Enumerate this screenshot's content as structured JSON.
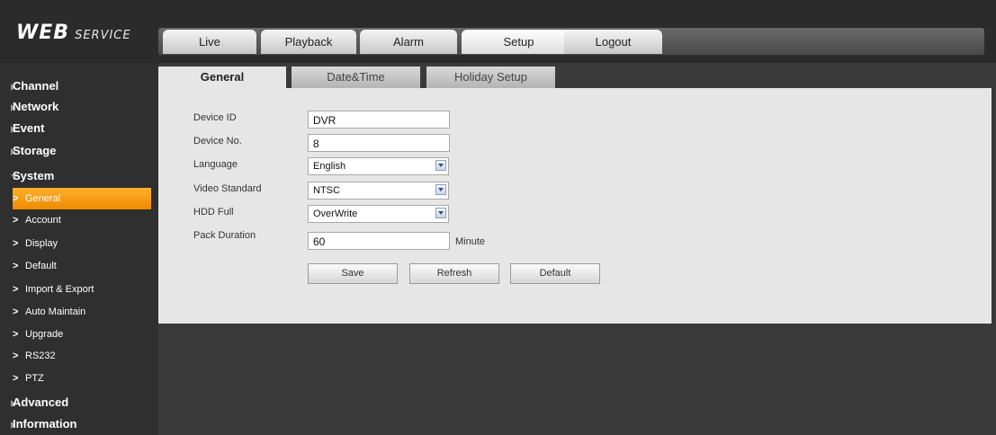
{
  "logo": {
    "big": "WEB",
    "small": "SERVICE"
  },
  "top_tabs": [
    {
      "label": "Live"
    },
    {
      "label": "Playback"
    },
    {
      "label": "Alarm"
    },
    {
      "label": "Setup",
      "active": true
    },
    {
      "label": "Logout"
    }
  ],
  "sidebar": {
    "categories": {
      "channel": "Channel",
      "network": "Network",
      "event": "Event",
      "storage": "Storage",
      "system": "System",
      "advanced": "Advanced",
      "information": "Information"
    },
    "system_items": {
      "general": "General",
      "account": "Account",
      "display": "Display",
      "default": "Default",
      "import_export": "Import & Export",
      "auto_maintain": "Auto Maintain",
      "upgrade": "Upgrade",
      "rs232": "RS232",
      "ptz": "PTZ"
    },
    "active_item": "General",
    "arrow": ">"
  },
  "sub_tabs": [
    {
      "label": "General",
      "active": true
    },
    {
      "label": "Date&Time"
    },
    {
      "label": "Holiday Setup"
    }
  ],
  "form": {
    "device_id": {
      "label": "Device ID",
      "value": "DVR"
    },
    "device_no": {
      "label": "Device No.",
      "value": "8"
    },
    "language": {
      "label": "Language",
      "value": "English"
    },
    "video_standard": {
      "label": "Video Standard",
      "value": "NTSC"
    },
    "hdd_full": {
      "label": "HDD Full",
      "value": "OverWrite"
    },
    "pack_duration": {
      "label": "Pack Duration",
      "value": "60",
      "unit": "Minute"
    }
  },
  "buttons": {
    "save": "Save",
    "refresh": "Refresh",
    "default": "Default"
  },
  "colors": {
    "accent": "#f5980f",
    "background": "#3a3a3a",
    "panel": "#e6e6e6"
  },
  "icons": {
    "category": "triangle-right-icon",
    "expanded": "triangle-down-icon",
    "dropdown": "chevron-down-icon"
  }
}
